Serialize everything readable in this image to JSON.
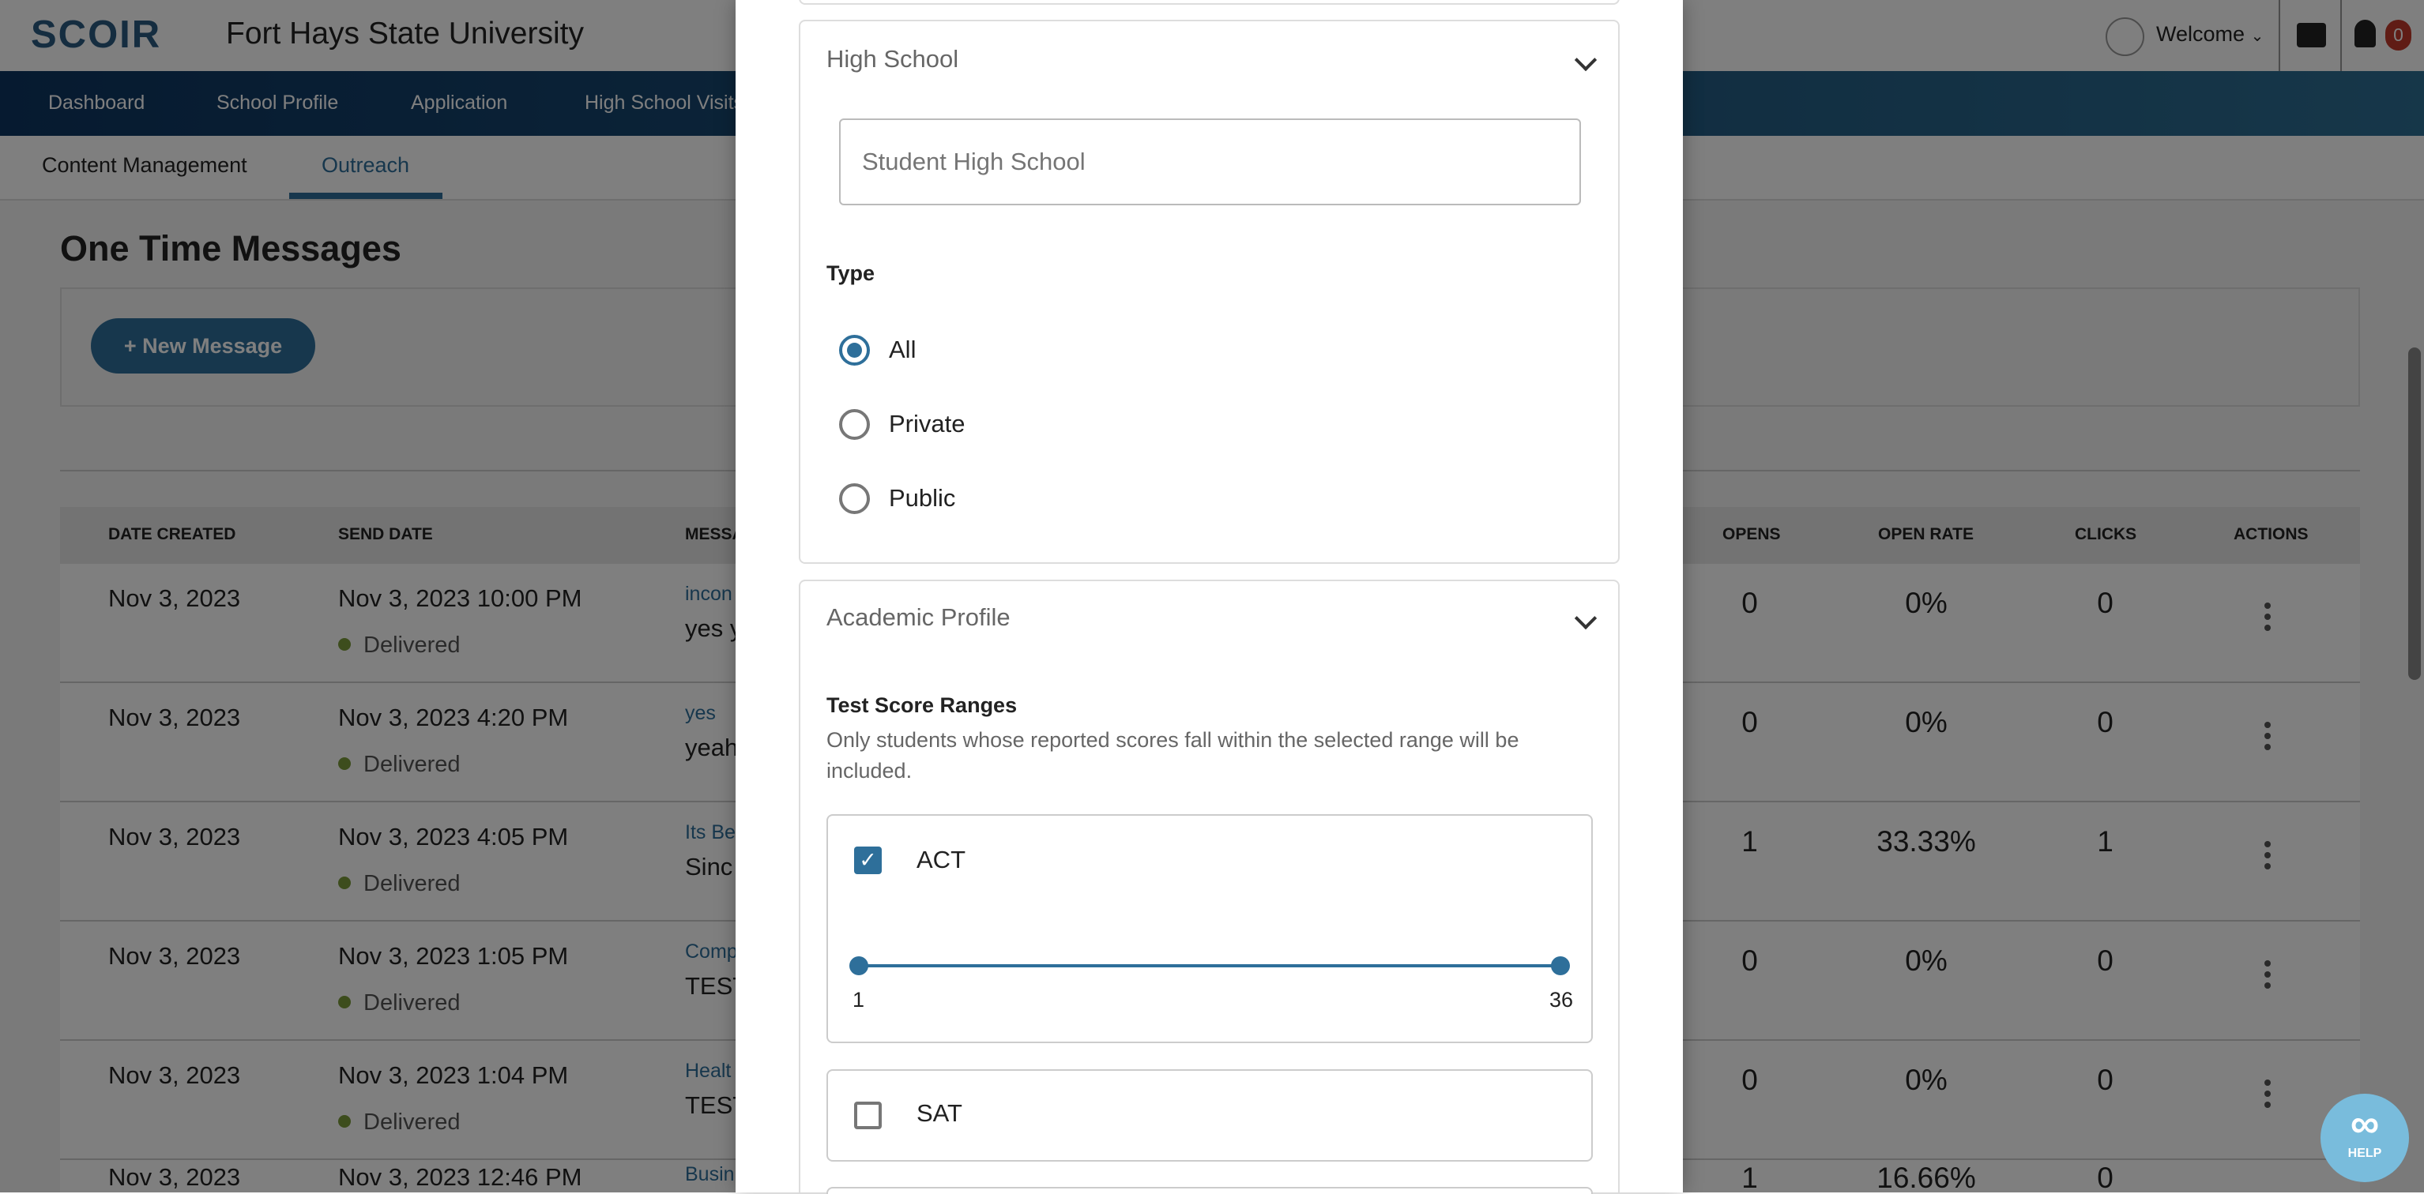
{
  "header": {
    "logo": "SCOIR",
    "school_name": "Fort Hays State University",
    "welcome": "Welcome",
    "notification_count": "0"
  },
  "nav": {
    "items": [
      "Dashboard",
      "School Profile",
      "Application",
      "High School Visits"
    ]
  },
  "subnav": {
    "items": [
      "Content Management",
      "Outreach"
    ],
    "active": "Outreach"
  },
  "main": {
    "title": "One Time Messages",
    "new_message": "+ New Message",
    "columns": [
      "DATE CREATED",
      "SEND DATE",
      "MESSAGE",
      "OPENS",
      "OPEN RATE",
      "CLICKS",
      "ACTIONS"
    ],
    "rows": [
      {
        "created": "Nov 3, 2023",
        "send": "Nov 3, 2023 10:00 PM",
        "status": "Delivered",
        "subject": "incon",
        "body": "yes y",
        "opens": "0",
        "rate": "0%",
        "clicks": "0"
      },
      {
        "created": "Nov 3, 2023",
        "send": "Nov 3, 2023 4:20 PM",
        "status": "Delivered",
        "subject": "yes",
        "body": "yeah",
        "opens": "0",
        "rate": "0%",
        "clicks": "0"
      },
      {
        "created": "Nov 3, 2023",
        "send": "Nov 3, 2023 4:05 PM",
        "status": "Delivered",
        "subject": "Its Be",
        "body": "Sinc",
        "opens": "1",
        "rate": "33.33%",
        "clicks": "1"
      },
      {
        "created": "Nov 3, 2023",
        "send": "Nov 3, 2023 1:05 PM",
        "status": "Delivered",
        "subject": "Comp",
        "body": "TEST",
        "opens": "0",
        "rate": "0%",
        "clicks": "0"
      },
      {
        "created": "Nov 3, 2023",
        "send": "Nov 3, 2023 1:04 PM",
        "status": "Delivered",
        "subject": "Healt",
        "body": "TEST",
        "opens": "0",
        "rate": "0%",
        "clicks": "0"
      },
      {
        "created": "Nov 3, 2023",
        "send": "Nov 3, 2023 12:46 PM",
        "status": "",
        "subject": "Busin",
        "body": "",
        "opens": "1",
        "rate": "16.66%",
        "clicks": "0"
      }
    ]
  },
  "modal": {
    "high_school": {
      "title": "High School",
      "input_placeholder": "Student High School",
      "type_label": "Type",
      "options": [
        "All",
        "Private",
        "Public"
      ],
      "selected": "All"
    },
    "academic": {
      "title": "Academic Profile",
      "score_title": "Test Score Ranges",
      "score_desc": "Only students whose reported scores fall within the selected range will be included.",
      "act": {
        "label": "ACT",
        "checked": true,
        "min": "1",
        "max": "36",
        "range_low": 1,
        "range_high": 36
      },
      "sat": {
        "label": "SAT",
        "checked": false
      }
    }
  },
  "help": {
    "label": "HELP"
  },
  "colors": {
    "accent": "#2e6f9a",
    "delivered": "#7a9a3a",
    "badge": "#c0392b"
  }
}
